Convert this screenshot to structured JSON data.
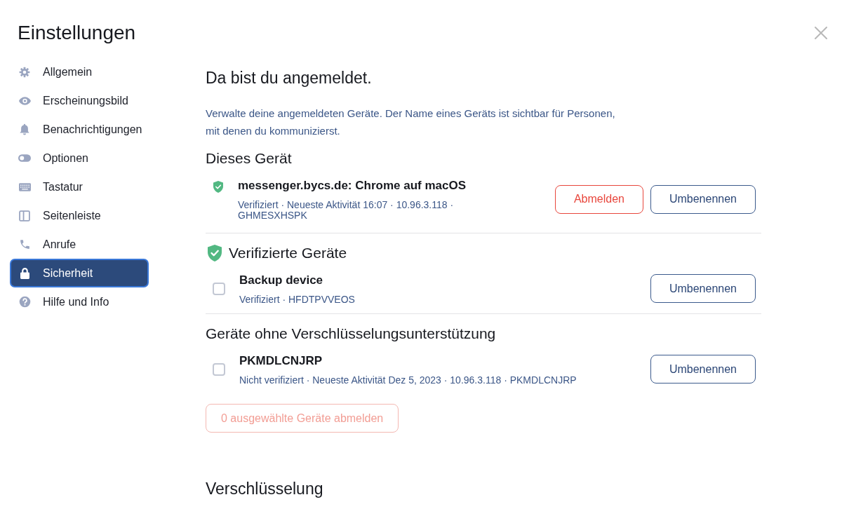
{
  "title": "Einstellungen",
  "sidebar": {
    "items": [
      {
        "label": "Allgemein",
        "selected": false
      },
      {
        "label": "Erscheinungsbild",
        "selected": false
      },
      {
        "label": "Benachrichtigungen",
        "selected": false
      },
      {
        "label": "Optionen",
        "selected": false
      },
      {
        "label": "Tastatur",
        "selected": false
      },
      {
        "label": "Seitenleiste",
        "selected": false
      },
      {
        "label": "Anrufe",
        "selected": false
      },
      {
        "label": "Sicherheit",
        "selected": true
      },
      {
        "label": "Hilfe und Info",
        "selected": false
      }
    ]
  },
  "main": {
    "heading": "Da bist du angemeldet.",
    "description": "Verwalte deine angemeldeten Geräte. Der Name eines Geräts ist sichtbar für Personen, mit denen du kommunizierst.",
    "sections": [
      {
        "kind": "current",
        "heading": "Dieses Gerät",
        "devices": [
          {
            "name": "messenger.bycs.de: Chrome auf macOS",
            "details": "Verifiziert · Neueste Aktivität 16:07 · 10.96.3.118 · GHMESXHSPK",
            "verified": true,
            "buttons": [
              {
                "label": "Abmelden",
                "kind": "danger"
              },
              {
                "label": "Umbenennen",
                "kind": "outline"
              }
            ]
          }
        ]
      },
      {
        "kind": "list",
        "heading": "Verifizierte Geräte",
        "verified": true,
        "devices": [
          {
            "name": "Backup device",
            "details": "Verifiziert · HFDTPVVEOS",
            "checked": false,
            "buttons": [
              {
                "label": "Umbenennen",
                "kind": "outline"
              }
            ]
          }
        ]
      },
      {
        "kind": "list",
        "heading": "Geräte ohne Verschlüsselungsunterstützung",
        "devices": [
          {
            "name": "PKMDLCNJRP",
            "details": "Nicht verifiziert · Neueste Aktivität Dez 5, 2023 · 10.96.3.118 · PKMDLCNJRP",
            "checked": false,
            "buttons": [
              {
                "label": "Umbenennen",
                "kind": "outline"
              }
            ]
          }
        ]
      }
    ],
    "bulk_sign_out": {
      "label": "0 ausgewählte Geräte abmelden",
      "disabled": true
    },
    "next_heading": "Verschlüsselung"
  }
}
